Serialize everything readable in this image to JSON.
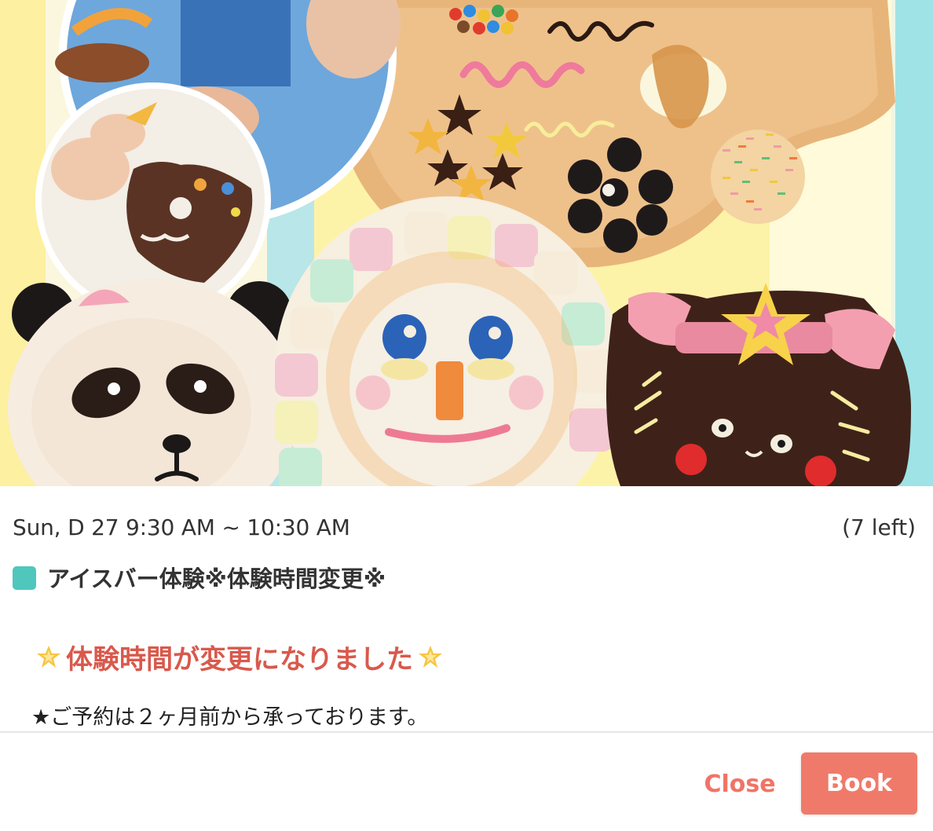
{
  "event": {
    "datetime": "Sun, D 27 9:30 AM ~ 10:30 AM",
    "slots_left": "(7 left)",
    "title": "アイスバー体験※体験時間変更※",
    "color": "#4fc7bd"
  },
  "notice": {
    "text": "体験時間が変更になりました",
    "color": "#d9594c",
    "icon": "glowing-star-icon"
  },
  "description": {
    "text": "★ご予約は２ヶ月前から承っております。"
  },
  "actions": {
    "close_label": "Close",
    "book_label": "Book",
    "close_color": "#f07466",
    "book_color": "#f07a6a"
  }
}
